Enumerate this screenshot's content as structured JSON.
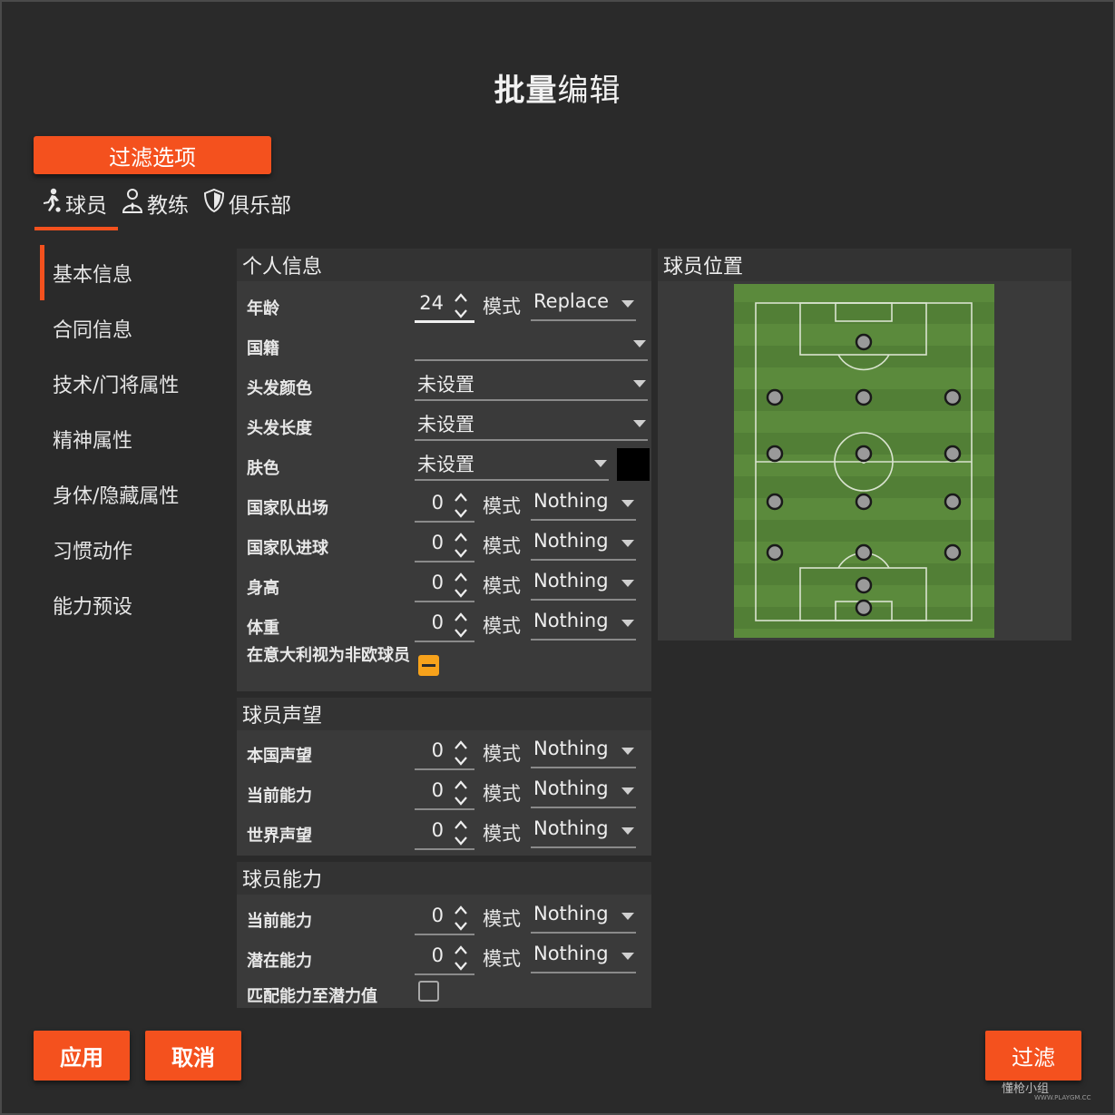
{
  "title": {
    "bold": "批量",
    "light": "编辑"
  },
  "filter_options_label": "过滤选项",
  "type_tabs": [
    {
      "label": "球员",
      "icon": "player-icon"
    },
    {
      "label": "教练",
      "icon": "coach-icon"
    },
    {
      "label": "俱乐部",
      "icon": "club-shield-icon"
    }
  ],
  "sidebar": {
    "items": [
      {
        "label": "基本信息",
        "active": true
      },
      {
        "label": "合同信息"
      },
      {
        "label": "技术/门将属性"
      },
      {
        "label": "精神属性"
      },
      {
        "label": "身体/隐藏属性"
      },
      {
        "label": "习惯动作"
      },
      {
        "label": "能力预设"
      }
    ]
  },
  "mode_label": "模式",
  "personal": {
    "header": "个人信息",
    "age": {
      "label": "年龄",
      "value": "24",
      "mode": "Replace"
    },
    "nationality": {
      "label": "国籍",
      "value": ""
    },
    "hair_color": {
      "label": "头发颜色",
      "value": "未设置"
    },
    "hair_length": {
      "label": "头发长度",
      "value": "未设置"
    },
    "skin": {
      "label": "肤色",
      "value": "未设置",
      "swatch": "#000000"
    },
    "caps": {
      "label": "国家队出场",
      "value": "0",
      "mode": "Nothing"
    },
    "goals": {
      "label": "国家队进球",
      "value": "0",
      "mode": "Nothing"
    },
    "height": {
      "label": "身高",
      "value": "0",
      "mode": "Nothing"
    },
    "weight": {
      "label": "体重",
      "value": "0",
      "mode": "Nothing"
    },
    "italy_non_eu": {
      "label": "在意大利视为非欧球员",
      "state": "indeterminate"
    }
  },
  "reputation": {
    "header": "球员声望",
    "home": {
      "label": "本国声望",
      "value": "0",
      "mode": "Nothing"
    },
    "current": {
      "label": "当前能力",
      "value": "0",
      "mode": "Nothing"
    },
    "world": {
      "label": "世界声望",
      "value": "0",
      "mode": "Nothing"
    }
  },
  "ability": {
    "header": "球员能力",
    "current": {
      "label": "当前能力",
      "value": "0",
      "mode": "Nothing"
    },
    "potential": {
      "label": "潜在能力",
      "value": "0",
      "mode": "Nothing"
    },
    "match": {
      "label": "匹配能力至潜力值",
      "state": "unchecked"
    }
  },
  "positions": {
    "header": "球员位置"
  },
  "buttons": {
    "apply": "应用",
    "cancel": "取消",
    "filter": "过滤"
  },
  "watermark": {
    "text": "懂枪小组",
    "sub": "WWW.PLAYGM.CC"
  },
  "colors": {
    "accent": "#f4511e",
    "checkbox": "#f7a21b",
    "pitch": "#5a8a3a"
  }
}
